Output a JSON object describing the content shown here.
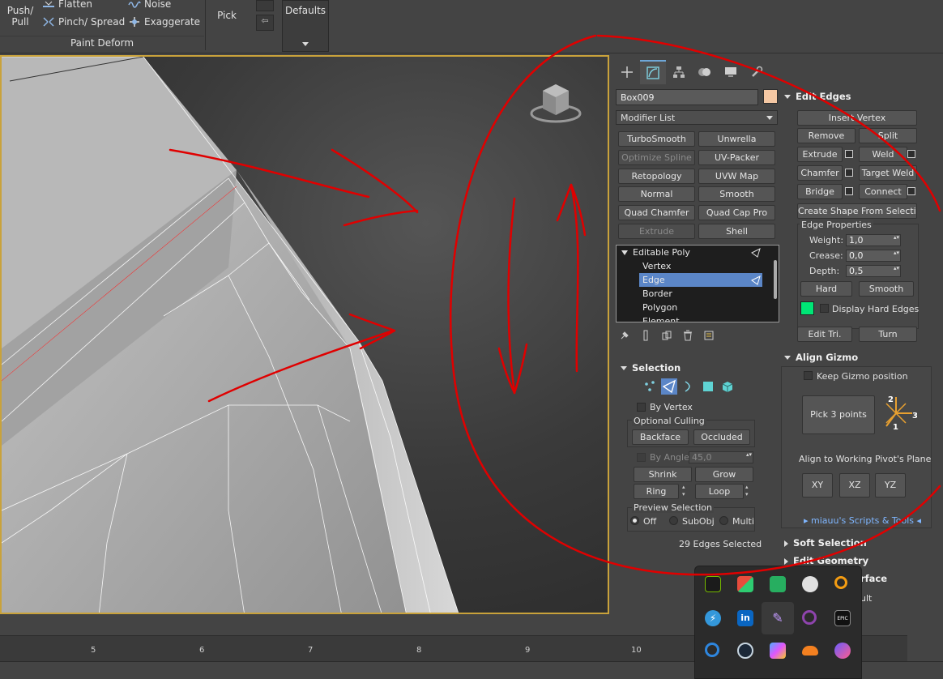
{
  "ribbon": {
    "push_pull": "Push/\nPull",
    "flatten": "Flatten",
    "noise": "Noise",
    "pinch_spread": "Pinch/ Spread",
    "exaggerate": "Exaggerate",
    "pick": "Pick",
    "group_label": "Paint Deform",
    "defaults": "Defaults"
  },
  "timeline": {
    "ticks": [
      "5",
      "6",
      "7",
      "8",
      "9",
      "10"
    ]
  },
  "command_panel": {
    "object_name": "Box009",
    "object_color": "#f5c8a4",
    "modifier_list": "Modifier List",
    "modifier_buttons": [
      "TurboSmooth",
      "Unwrella",
      "Optimize Spline",
      "UV-Packer",
      "Retopology",
      "UVW Map",
      "Normal",
      "Smooth",
      "Quad Chamfer",
      "Quad Cap Pro",
      "Extrude",
      "Shell"
    ],
    "stack": {
      "root": "Editable Poly",
      "items": [
        "Vertex",
        "Edge",
        "Border",
        "Polygon",
        "Element"
      ]
    },
    "selection": {
      "title": "Selection",
      "by_vertex": "By Vertex",
      "optional_culling": "Optional Culling",
      "backface": "Backface",
      "occluded": "Occluded",
      "by_angle": "By Angle:",
      "by_angle_value": "45,0",
      "shrink": "Shrink",
      "grow": "Grow",
      "ring": "Ring",
      "loop": "Loop",
      "preview_selection": "Preview Selection",
      "off": "Off",
      "subobj": "SubObj",
      "multi": "Multi",
      "status": "29 Edges Selected"
    },
    "edit_edges": {
      "title": "Edit Edges",
      "insert_vertex": "Insert Vertex",
      "remove": "Remove",
      "split": "Split",
      "extrude": "Extrude",
      "weld": "Weld",
      "chamfer": "Chamfer",
      "target_weld": "Target Weld",
      "bridge": "Bridge",
      "connect": "Connect",
      "create_shape": "Create Shape From Selection",
      "edge_properties": "Edge Properties",
      "weight": "Weight:",
      "weight_value": "1,0",
      "crease": "Crease:",
      "crease_value": "0,0",
      "depth": "Depth:",
      "depth_value": "0,5",
      "hard": "Hard",
      "smooth": "Smooth",
      "display_hard_edges": "Display Hard Edges",
      "hard_edge_color": "#00e676",
      "edit_tri": "Edit Tri.",
      "turn": "Turn"
    },
    "align_gizmo": {
      "title": "Align Gizmo",
      "keep_gizmo": "Keep Gizmo position",
      "pick_3_points": "Pick 3 points",
      "axis_labels": [
        "2",
        "3",
        "1"
      ],
      "align_to_pivot": "Align to Working Pivot's Plane",
      "xy": "XY",
      "xz": "XZ",
      "yz": "YZ",
      "scripts_link": "▸ miauu's Scripts & Tools ◂"
    },
    "soft_selection": "Soft Selection",
    "edit_geometry": "Edit Geometry",
    "surface_partial": "rface",
    "ult_partial": "ult"
  },
  "tray": {
    "icons": [
      "nvidia-icon",
      "store-icon",
      "green-bag-icon",
      "discord-icon",
      "search-tool-icon",
      "bolt-icon",
      "linkedin-icon",
      "feather-icon",
      "ring-icon",
      "epic-games-icon",
      "blue-swirl-icon",
      "steam-icon",
      "copilot-icon",
      "cloudflare-icon",
      "messenger-icon"
    ],
    "epic_label": "EPIC"
  },
  "colors": {
    "accent": "#5b86c7",
    "viewport_border": "#c9a23b",
    "annotation": "#e00000"
  }
}
